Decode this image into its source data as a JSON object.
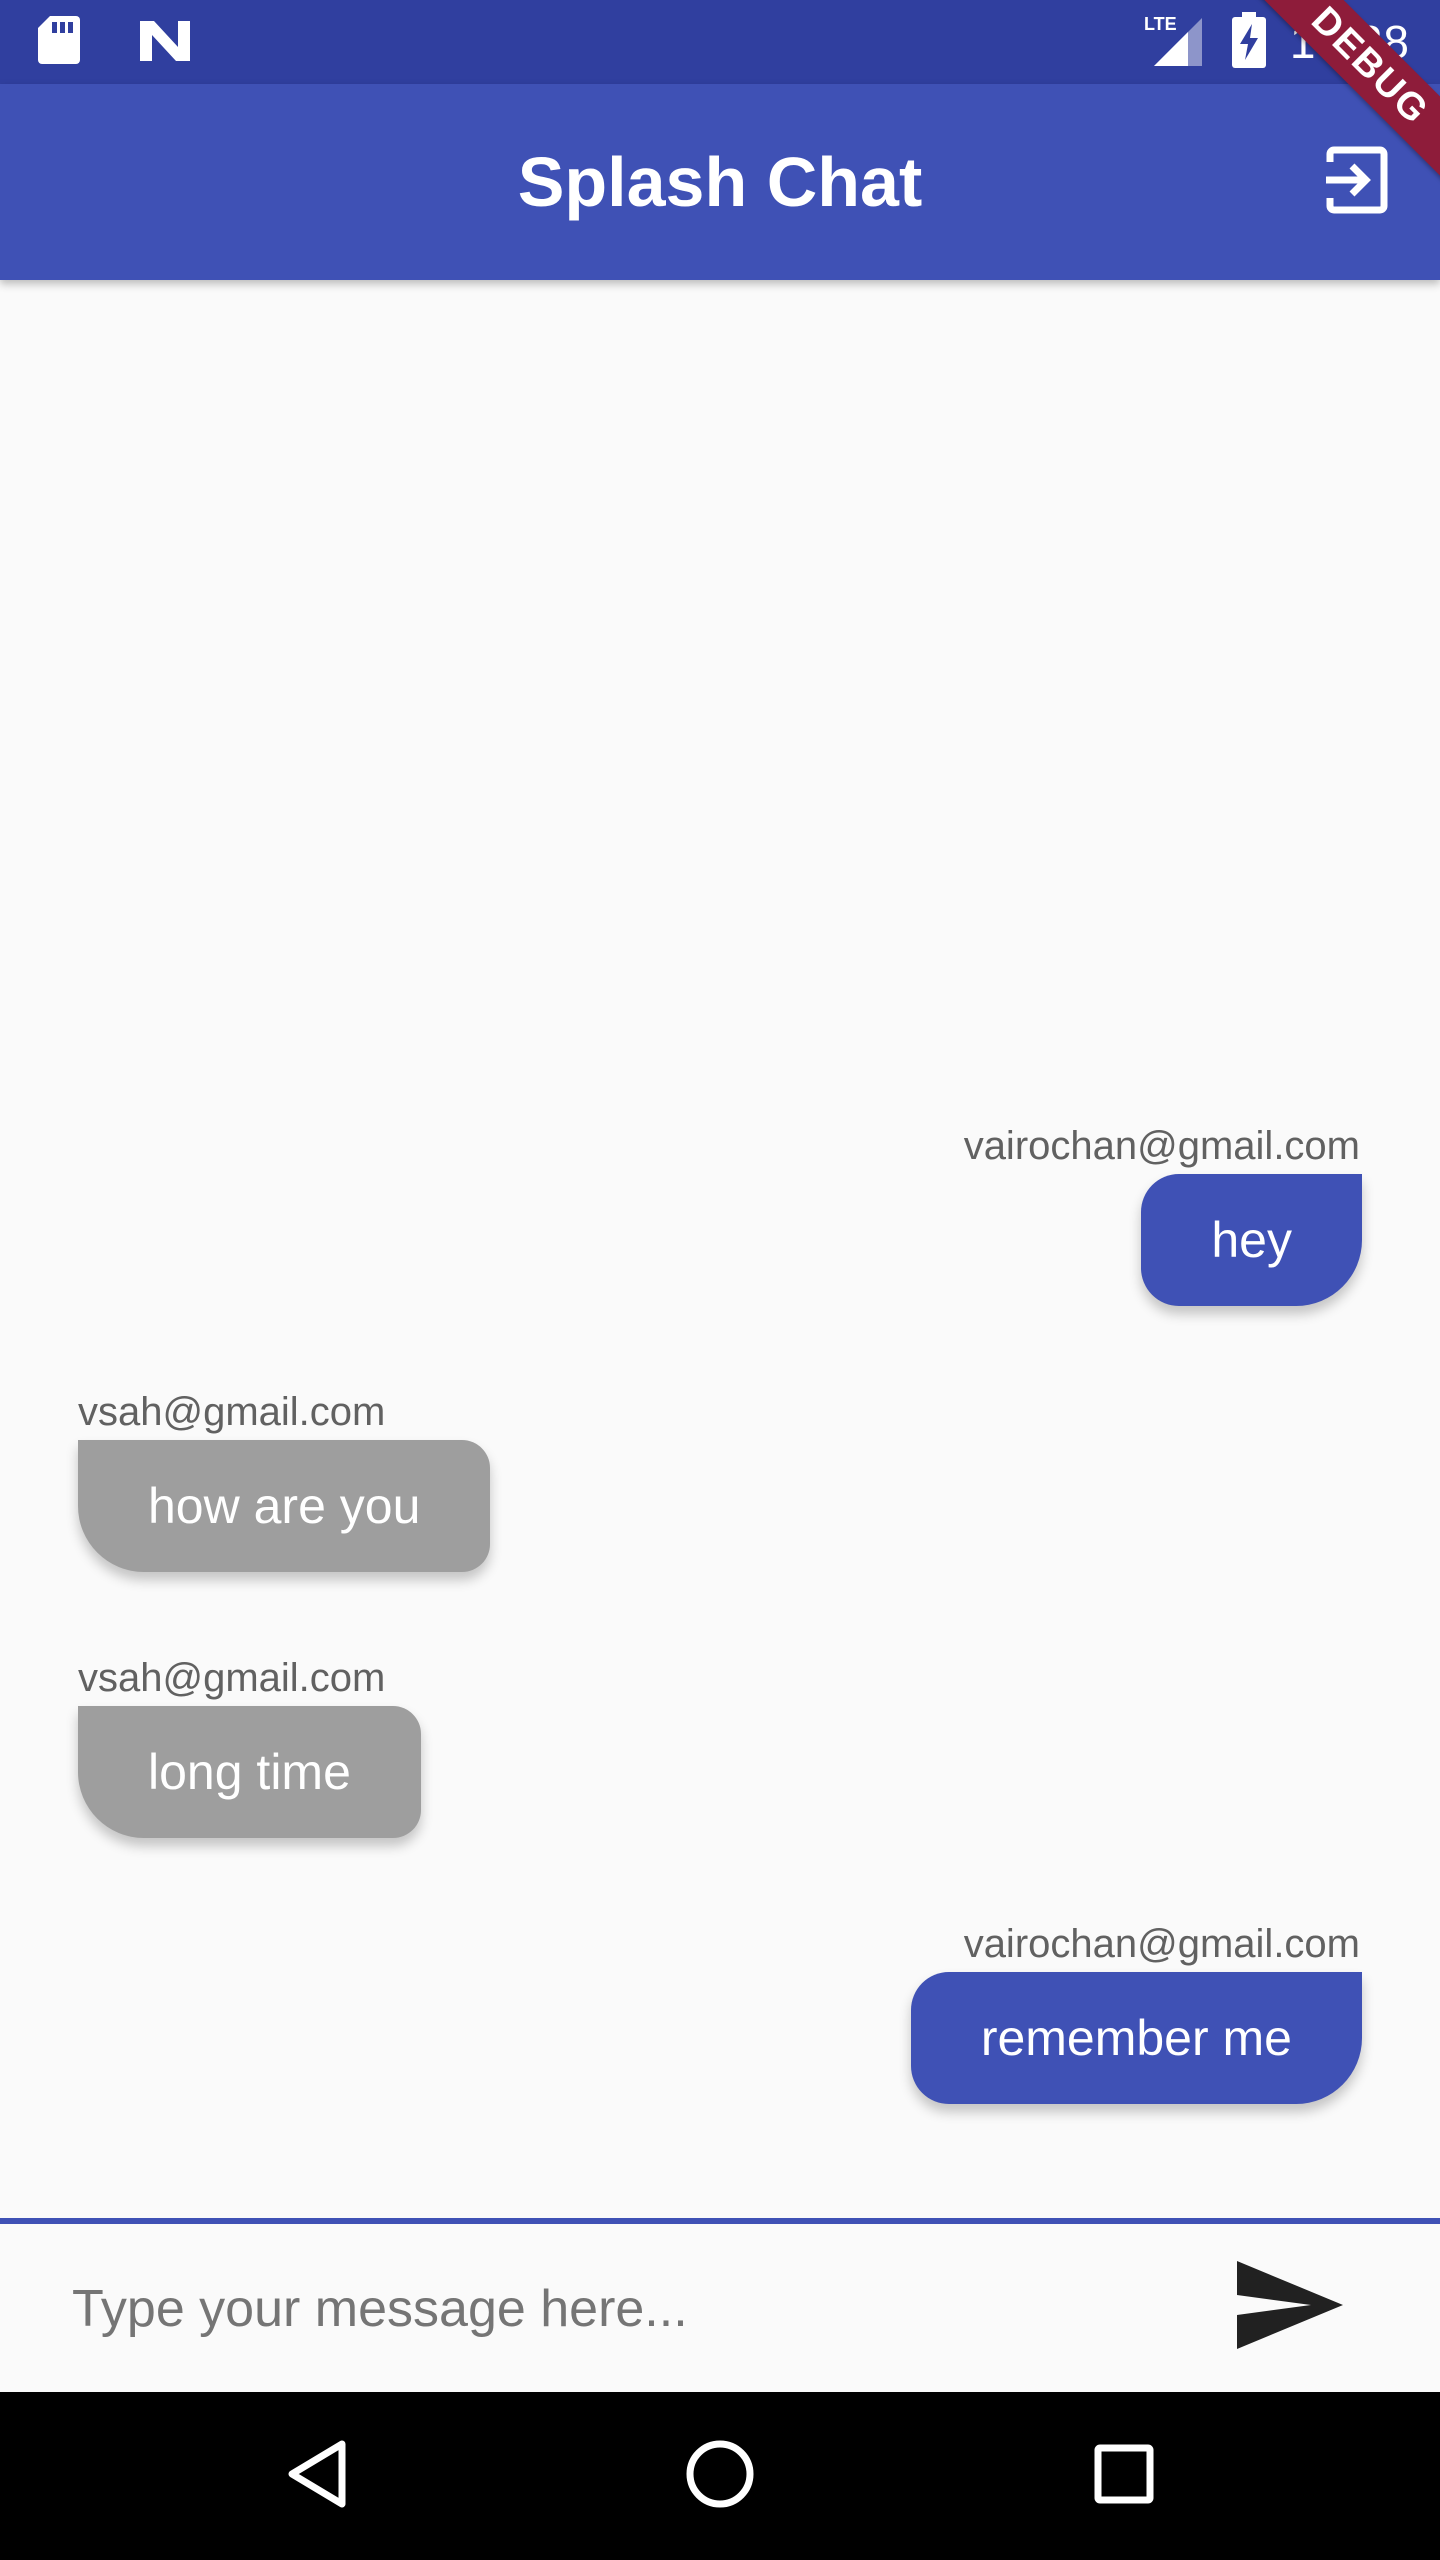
{
  "status_bar": {
    "time": "10:28",
    "network": "LTE",
    "left_icons": [
      "sd-card-icon",
      "n-notification-icon"
    ],
    "right_icons": [
      "lte-signal-icon",
      "battery-charging-icon"
    ]
  },
  "debug_banner": "DEBUG",
  "app_bar": {
    "title": "Splash Chat",
    "action_icon": "logout-icon"
  },
  "messages": [
    {
      "sender": "vairochan@gmail.com",
      "text": "hey",
      "side": "right"
    },
    {
      "sender": "vsah@gmail.com",
      "text": "how are you",
      "side": "left"
    },
    {
      "sender": "vsah@gmail.com",
      "text": "long time",
      "side": "left"
    },
    {
      "sender": "vairochan@gmail.com",
      "text": "remember me",
      "side": "right"
    }
  ],
  "composer": {
    "placeholder": "Type your message here...",
    "value": "",
    "send_icon": "send-icon"
  },
  "nav_bar": {
    "icons": [
      "back-triangle-icon",
      "home-circle-icon",
      "recents-square-icon"
    ]
  },
  "colors": {
    "primary": "#3f51b5",
    "primary_dark": "#303f9f",
    "received_bubble": "#9e9e9e",
    "background": "#fafafa",
    "debug_banner": "#8e1c3a"
  }
}
